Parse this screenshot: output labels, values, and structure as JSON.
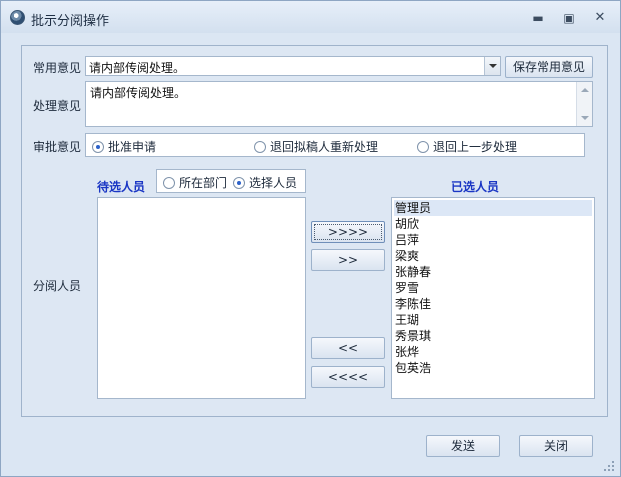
{
  "window": {
    "title": "批示分阅操作"
  },
  "labels": {
    "common_opinion": "常用意见",
    "process_opinion": "处理意见",
    "approval_opinion": "审批意见",
    "reviewers": "分阅人员",
    "pending_title": "待选人员",
    "selected_title": "已选人员"
  },
  "common_opinion": {
    "value": "请内部传阅处理。"
  },
  "save_button": "保存常用意见",
  "process_opinion": {
    "value": "请内部传阅处理。"
  },
  "approval": {
    "options": [
      {
        "label": "批准申请",
        "selected": true
      },
      {
        "label": "退回拟稿人重新处理",
        "selected": false
      },
      {
        "label": "退回上一步处理",
        "selected": false
      }
    ]
  },
  "filter": {
    "options": [
      {
        "label": "所在部门",
        "selected": false
      },
      {
        "label": "选择人员",
        "selected": true
      }
    ]
  },
  "pending_list": [],
  "selected_list": [
    "管理员",
    "胡欣",
    "吕萍",
    "梁爽",
    "张静春",
    "罗雪",
    "李陈佳",
    "王瑚",
    "秀景琪",
    "张烨",
    "包英浩"
  ],
  "move_buttons": {
    "add_all": ">>>>",
    "add": ">>",
    "remove": "<<",
    "remove_all": "<<<<"
  },
  "footer": {
    "send": "发送",
    "close": "关闭"
  }
}
